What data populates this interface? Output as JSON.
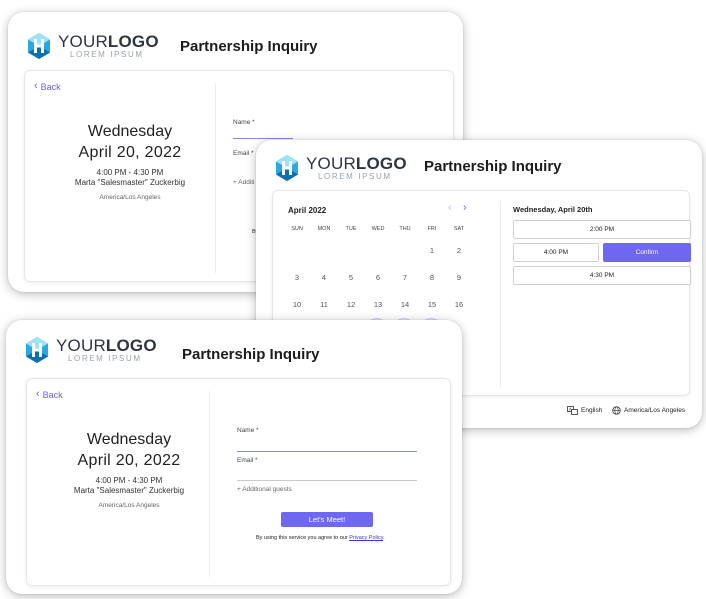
{
  "brand": {
    "logo_light": "YOUR",
    "logo_bold": "LOGO",
    "logo_sub": "LOREM IPSUM",
    "logo_mark_colors": [
      "#9be3f5",
      "#2aa9e0",
      "#0c6fb0"
    ]
  },
  "app_title": "Partnership Inquiry",
  "accent_color": "#6e67ef",
  "event": {
    "weekday": "Wednesday",
    "date": "April 20, 2022",
    "time_range": "4:00 PM - 4:30 PM",
    "host": "Marta \"Salesmaster\" Zuckerbig",
    "timezone": "America/Los Angeles"
  },
  "form": {
    "back_label": "Back",
    "name_label": "Name *",
    "email_label": "Email *",
    "guests_label": "+ Additional guests",
    "guests_label_cut": "+ Additi",
    "submit_label": "Let's Meet!",
    "terms_prefix": "By using this service you agree to our ",
    "terms_link": "Privacy Policy",
    "terms_suffix": ".",
    "terms_cut": "By"
  },
  "calendar": {
    "month": "April 2022",
    "weekdays": [
      "SUN",
      "MON",
      "TUE",
      "WED",
      "THU",
      "FRI",
      "SAT"
    ],
    "rows": [
      [
        "",
        "",
        "",
        "",
        "",
        "1",
        "2"
      ],
      [
        "3",
        "4",
        "5",
        "6",
        "7",
        "8",
        "9"
      ],
      [
        "10",
        "11",
        "12",
        "13",
        "14",
        "15",
        "16"
      ]
    ],
    "selected_date_heading": "Wednesday, April 20th",
    "slots": [
      "2:00 PM",
      "4:00 PM",
      "4:30 PM"
    ],
    "confirm_label": "Confirm",
    "footer_language": "English",
    "footer_timezone": "America/Los Angeles"
  }
}
